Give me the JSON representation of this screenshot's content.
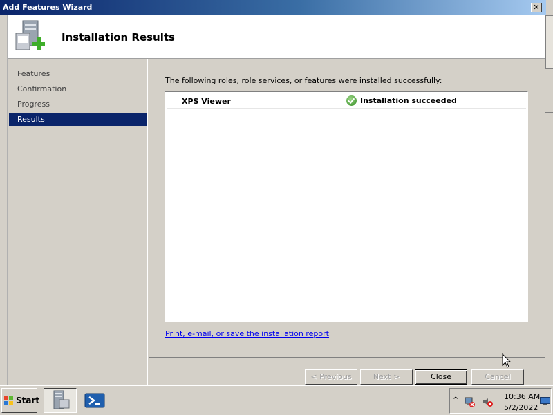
{
  "window": {
    "title": "Add Features Wizard",
    "close_label": "✕"
  },
  "header": {
    "title": "Installation Results"
  },
  "nav": {
    "items": [
      {
        "label": "Features",
        "active": false
      },
      {
        "label": "Confirmation",
        "active": false
      },
      {
        "label": "Progress",
        "active": false
      },
      {
        "label": "Results",
        "active": true
      }
    ]
  },
  "content": {
    "intro": "The following roles, role services, or features were installed successfully:",
    "results": [
      {
        "feature": "XPS Viewer",
        "status": "Installation succeeded",
        "status_icon": "check-circle-icon"
      }
    ],
    "report_link": "Print, e-mail, or save the installation report"
  },
  "buttons": {
    "previous": "< Previous",
    "next": "Next >",
    "close": "Close",
    "cancel": "Cancel"
  },
  "taskbar": {
    "start_label": "Start",
    "tray_chevron": "^",
    "time": "10:36 AM",
    "date": "5/2/2022"
  },
  "colors": {
    "title_start": "#0a246a",
    "title_end": "#a6caf0",
    "nav_active": "#0a246a",
    "success": "#2f8a1f",
    "link": "#0000ee"
  }
}
